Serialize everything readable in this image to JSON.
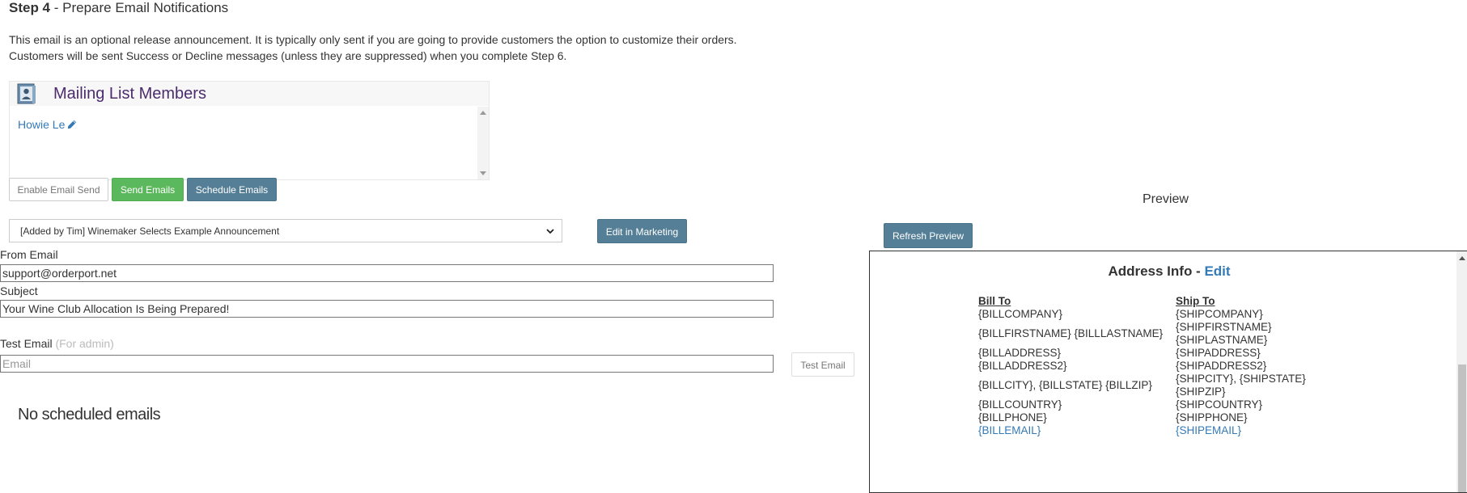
{
  "header": {
    "step_label": "Step 4",
    "step_title": " - Prepare Email Notifications",
    "intro_line1": "This email is an optional release announcement. It is typically only sent if you are going to provide customers the option to customize their orders.",
    "intro_line2": "Customers will be sent Success or Decline messages (unless they are suppressed) when you complete Step 6."
  },
  "mailing_list": {
    "title": "Mailing List Members",
    "members": [
      "Howie Le"
    ]
  },
  "actions": {
    "enable_label": "Enable Email Send",
    "send_label": "Send Emails",
    "schedule_label": "Schedule Emails"
  },
  "template": {
    "selected": "[Added by Tim] Winemaker Selects Example Announcement",
    "edit_label": "Edit in Marketing"
  },
  "form": {
    "from_label": "From Email",
    "from_value": "support@orderport.net",
    "subject_label": "Subject",
    "subject_value": "Your Wine Club Allocation Is Being Prepared!",
    "test_label": "Test Email",
    "test_hint": "(For admin)",
    "test_placeholder": "Email",
    "test_button": "Test Email"
  },
  "scheduled": {
    "empty_text": "No scheduled emails"
  },
  "preview": {
    "title": "Preview",
    "refresh_label": "Refresh Preview",
    "address_title": "Address Info - ",
    "edit_link": "Edit",
    "bill": {
      "heading": "Bill To",
      "company": "{BILLCOMPANY}",
      "name": "{BILLFIRSTNAME} {BILLLASTNAME}",
      "address1": "{BILLADDRESS}",
      "address2": "{BILLADDRESS2}",
      "city_state_zip": "{BILLCITY}, {BILLSTATE}  {BILLZIP}",
      "country": "{BILLCOUNTRY}",
      "phone": "{BILLPHONE}",
      "email": "{BILLEMAIL}"
    },
    "ship": {
      "heading": "Ship To",
      "company": "{SHIPCOMPANY}",
      "firstname": "{SHIPFIRSTNAME}",
      "lastname": "{SHIPLASTNAME}",
      "address1": "{SHIPADDRESS}",
      "address2": "{SHIPADDRESS2}",
      "city_state": "{SHIPCITY}, {SHIPSTATE}",
      "zip": "{SHIPZIP}",
      "country": "{SHIPCOUNTRY}",
      "phone": "{SHIPPHONE}",
      "email": "{SHIPEMAIL}"
    }
  },
  "colors": {
    "link": "#337ab7",
    "success": "#5cb85c",
    "primary": "#557f96",
    "panel_title": "#4b2c6f"
  },
  "icons": [
    "mailing-list-icon",
    "pencil-icon",
    "chevron-down-icon"
  ]
}
